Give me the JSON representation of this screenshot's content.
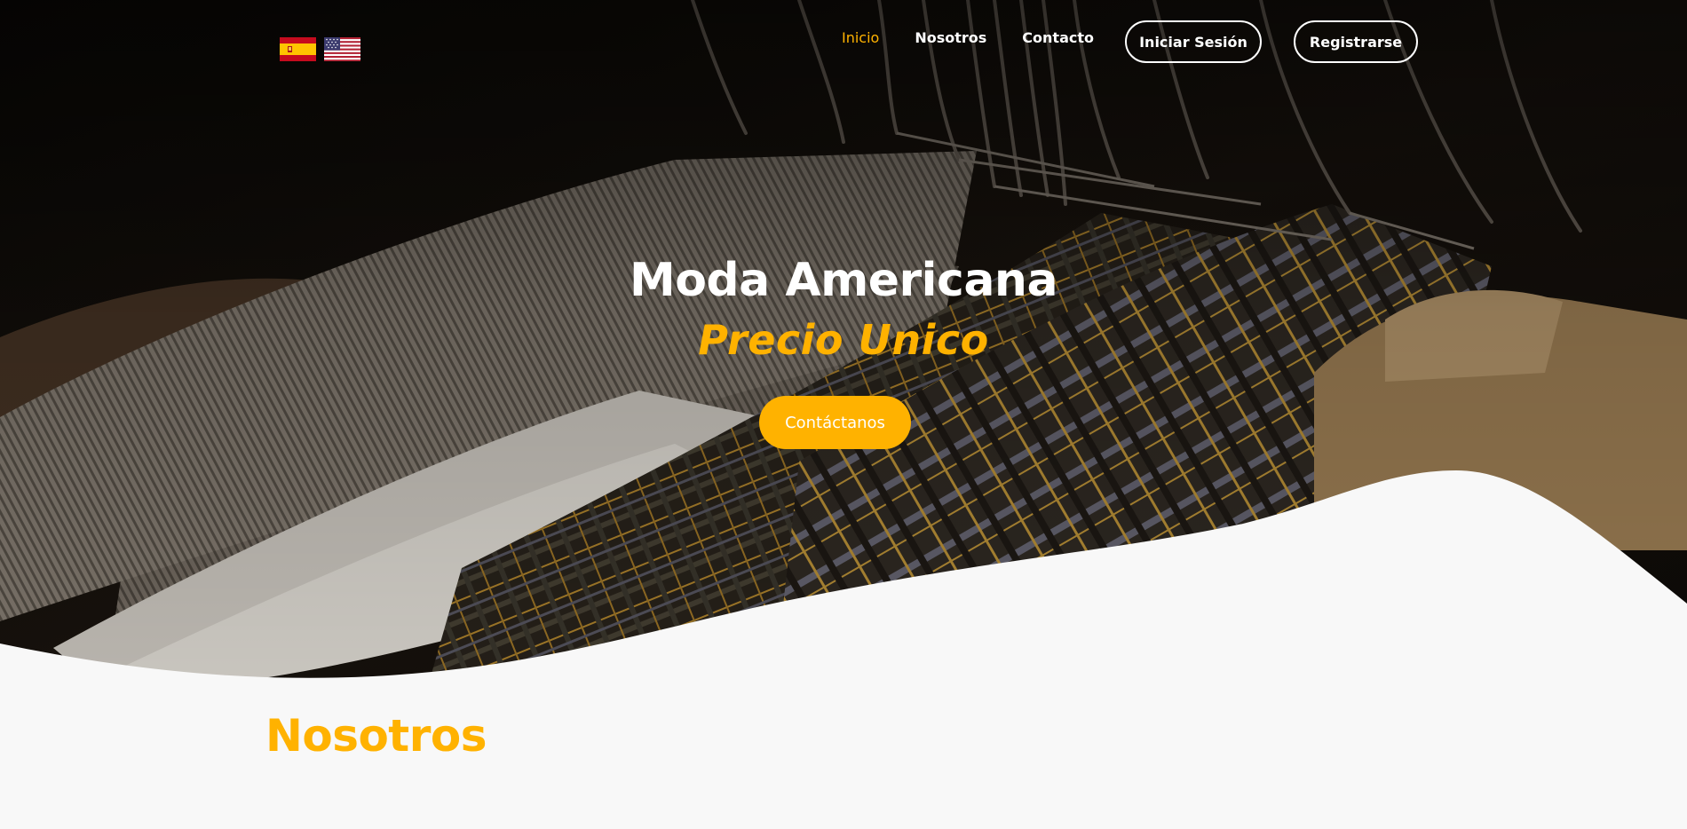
{
  "languages": [
    {
      "code": "es",
      "flag": "spain-flag-icon"
    },
    {
      "code": "en",
      "flag": "usa-flag-icon"
    }
  ],
  "nav": {
    "links": [
      {
        "label": "Inicio",
        "active": true
      },
      {
        "label": "Nosotros",
        "active": false
      },
      {
        "label": "Contacto",
        "active": false
      }
    ]
  },
  "auth": {
    "login_label": "Iniciar Sesión",
    "register_label": "Registrarse"
  },
  "hero": {
    "title": "Moda Americana",
    "subtitle": "Precio Unico",
    "cta_label": "Contáctanos"
  },
  "about": {
    "title": "Nosotros"
  },
  "colors": {
    "accent": "#ffb200",
    "background": "#f8f8f8",
    "text_light": "#ffffff"
  }
}
